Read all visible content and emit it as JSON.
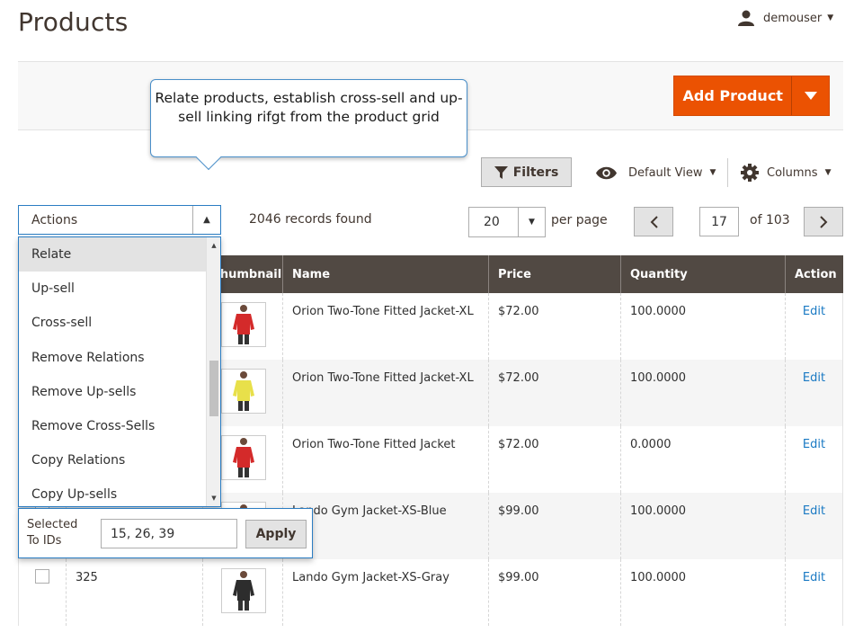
{
  "page": {
    "title": "Products"
  },
  "user": {
    "name": "demouser"
  },
  "tooltip": {
    "text": "Relate products, establish cross-sell and up-sell linking rifgt from the product grid"
  },
  "toolbar": {
    "add_product_label": "Add Product",
    "filters_label": "Filters",
    "view_label": "Default View",
    "columns_label": "Columns"
  },
  "actions": {
    "label": "Actions",
    "items": [
      "Relate",
      "Up-sell",
      "Cross-sell",
      "Remove Relations",
      "Remove Up-sells",
      "Remove Cross-Sells",
      "Copy Relations",
      "Copy Up-sells"
    ],
    "highlighted": "Relate",
    "selected_ids_label": "Selected To IDs",
    "selected_ids_value": "15, 26, 39",
    "apply_label": "Apply"
  },
  "records": {
    "text": "2046 records found"
  },
  "pagination": {
    "per_page": "20",
    "per_page_label": "per page",
    "current_page": "17",
    "of_label": "of 103"
  },
  "grid": {
    "headers": {
      "thumbnail": "Thumbnail",
      "name": "Name",
      "price": "Price",
      "quantity": "Quantity",
      "action": "Action"
    },
    "rows": [
      {
        "id": "",
        "name": "Orion Two-Tone Fitted Jacket-XL",
        "price": "$72.00",
        "quantity": "100.0000",
        "action": "Edit",
        "thumb_color": "#d42a2a"
      },
      {
        "id": "",
        "name": "Orion Two-Tone Fitted Jacket-XL",
        "price": "$72.00",
        "quantity": "100.0000",
        "action": "Edit",
        "thumb_color": "#e8e04a"
      },
      {
        "id": "",
        "name": "Orion Two-Tone Fitted Jacket",
        "price": "$72.00",
        "quantity": "0.0000",
        "action": "Edit",
        "thumb_color": "#d42a2a"
      },
      {
        "id": "",
        "name": "Lando Gym Jacket-XS-Blue",
        "price": "$99.00",
        "quantity": "100.0000",
        "action": "Edit",
        "thumb_color": "#2a5fb5"
      },
      {
        "id": "325",
        "name": "Lando Gym Jacket-XS-Gray",
        "price": "$99.00",
        "quantity": "100.0000",
        "action": "Edit",
        "thumb_color": "#2d2d2d"
      }
    ]
  },
  "colors": {
    "accent": "#eb5202",
    "header_bg": "#514943",
    "link": "#1979c3",
    "focus_border": "#2b7dc3"
  }
}
